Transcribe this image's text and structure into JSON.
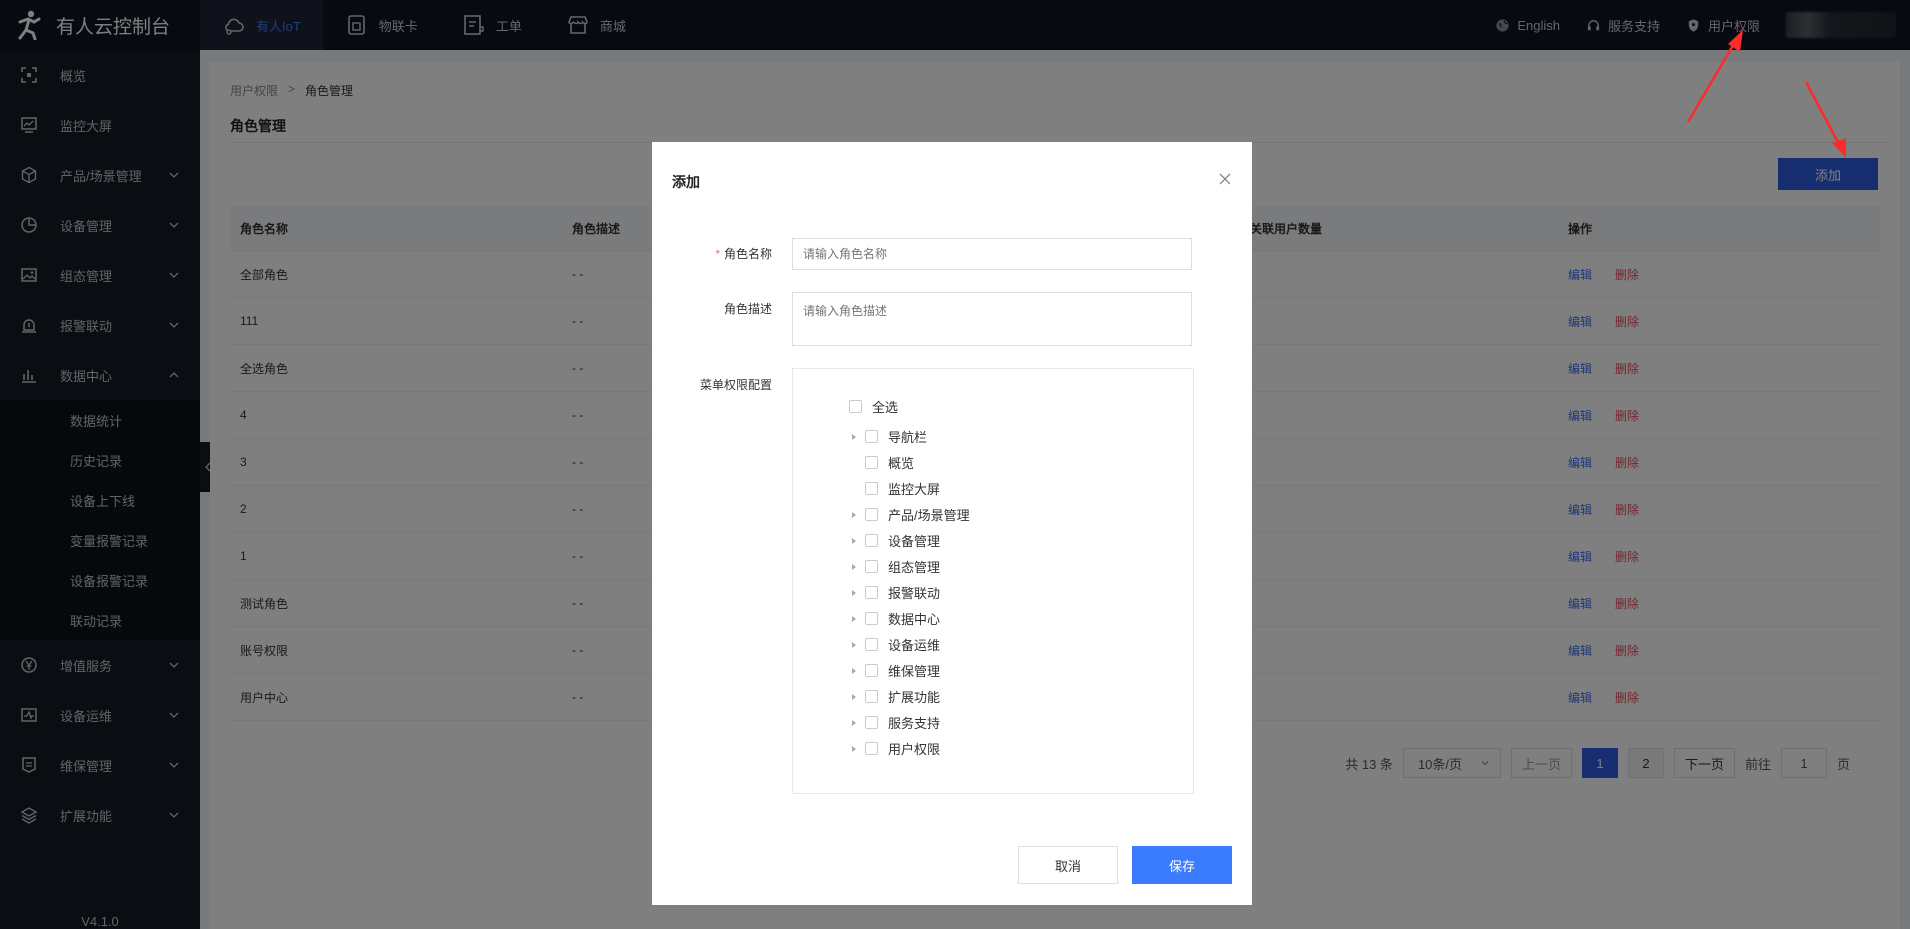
{
  "app": {
    "title": "有人云控制台",
    "version": "V4.1.0"
  },
  "topnav": [
    {
      "label": "有人IoT",
      "icon": "cloud-icon",
      "active": true
    },
    {
      "label": "物联卡",
      "icon": "sim-card-icon",
      "active": false
    },
    {
      "label": "工单",
      "icon": "ticket-icon",
      "active": false
    },
    {
      "label": "商城",
      "icon": "store-icon",
      "active": false
    }
  ],
  "topright": {
    "language": "English",
    "support": "服务支持",
    "user_perm": "用户权限"
  },
  "sidebar": {
    "items": [
      {
        "label": "概览",
        "icon": "overview-icon"
      },
      {
        "label": "监控大屏",
        "icon": "monitor-icon"
      },
      {
        "label": "产品/场景管理",
        "icon": "cube-icon"
      },
      {
        "label": "设备管理",
        "icon": "pie-icon"
      },
      {
        "label": "组态管理",
        "icon": "image-icon"
      },
      {
        "label": "报警联动",
        "icon": "alarm-icon"
      },
      {
        "label": "数据中心",
        "icon": "bar-chart-icon"
      }
    ],
    "sub_items": [
      "数据统计",
      "历史记录",
      "设备上下线",
      "变量报警记录",
      "设备报警记录",
      "联动记录"
    ],
    "items_after": [
      {
        "label": "增值服务",
        "icon": "yen-icon"
      },
      {
        "label": "设备运维",
        "icon": "ops-icon"
      },
      {
        "label": "维保管理",
        "icon": "maintenance-icon"
      },
      {
        "label": "扩展功能",
        "icon": "layers-icon"
      }
    ]
  },
  "breadcrumb": {
    "parent": "用户权限",
    "current": "角色管理"
  },
  "page": {
    "title": "角色管理",
    "add_label": "添加"
  },
  "table": {
    "headers": [
      "角色名称",
      "角色描述",
      "关联用户数量",
      "操作"
    ],
    "rows": [
      {
        "name": "全部角色",
        "desc": "- -"
      },
      {
        "name": "111",
        "desc": "- -"
      },
      {
        "name": "全选角色",
        "desc": "- -"
      },
      {
        "name": "4",
        "desc": "- -"
      },
      {
        "name": "3",
        "desc": "- -"
      },
      {
        "name": "2",
        "desc": "- -"
      },
      {
        "name": "1",
        "desc": "- -"
      },
      {
        "name": "测试角色",
        "desc": "- -"
      },
      {
        "name": "账号权限",
        "desc": "- -"
      },
      {
        "name": "用户中心",
        "desc": "- -"
      }
    ],
    "edit_label": "编辑",
    "delete_label": "删除"
  },
  "pager": {
    "total": "共 13 条",
    "page_size": "10条/页",
    "prev": "上一页",
    "pages": [
      "1",
      "2"
    ],
    "next": "下一页",
    "goto": "前往",
    "goto_value": "1",
    "page_suffix": "页"
  },
  "modal": {
    "title": "添加",
    "name_label": "角色名称",
    "name_placeholder": "请输入角色名称",
    "desc_label": "角色描述",
    "desc_placeholder": "请输入角色描述",
    "menu_label": "菜单权限配置",
    "select_all": "全选",
    "tree": [
      {
        "label": "导航栏",
        "expandable": true
      },
      {
        "label": "概览",
        "expandable": false
      },
      {
        "label": "监控大屏",
        "expandable": false
      },
      {
        "label": "产品/场景管理",
        "expandable": true
      },
      {
        "label": "设备管理",
        "expandable": true
      },
      {
        "label": "组态管理",
        "expandable": true
      },
      {
        "label": "报警联动",
        "expandable": true
      },
      {
        "label": "数据中心",
        "expandable": true
      },
      {
        "label": "设备运维",
        "expandable": true
      },
      {
        "label": "维保管理",
        "expandable": true
      },
      {
        "label": "扩展功能",
        "expandable": true
      },
      {
        "label": "服务支持",
        "expandable": true
      },
      {
        "label": "用户权限",
        "expandable": true
      }
    ],
    "cancel": "取消",
    "save": "保存"
  },
  "colors": {
    "primary": "#2f5fe0",
    "save": "#3b7cff",
    "danger": "#e74b5c",
    "topbar": "#111522",
    "sidebar": "#161a26",
    "annotation": "#ff2a2a"
  }
}
